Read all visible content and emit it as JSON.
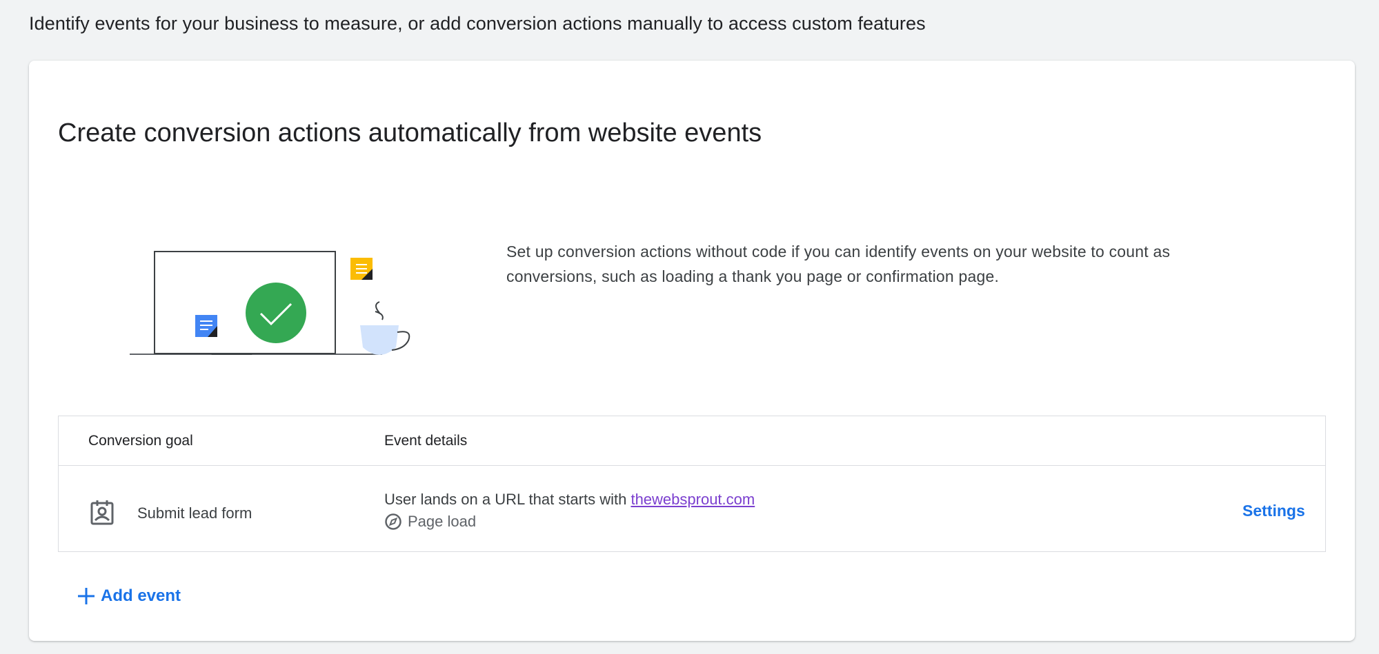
{
  "page": {
    "subtitle": "Identify events for your business to measure, or add conversion actions manually to access custom features"
  },
  "card": {
    "title": "Create conversion actions automatically from website events",
    "description": "Set up conversion actions without code if you can identify events on your website to count as conversions, such as loading a thank you page or confirmation page."
  },
  "table": {
    "headers": {
      "goal": "Conversion goal",
      "details": "Event details"
    },
    "rows": [
      {
        "goal": "Submit lead form",
        "goal_icon": "contact-form-icon",
        "event_prefix": "User lands on a URL that starts with ",
        "event_link": "thewebsprout.com",
        "event_type": "Page load",
        "event_type_icon": "compass-icon",
        "action": "Settings"
      }
    ]
  },
  "add_event": {
    "label": "Add event",
    "icon": "plus-icon"
  },
  "colors": {
    "accent": "#1a73e8",
    "link_visited": "#7b3fcf",
    "success": "#34a853",
    "background": "#f1f3f4"
  }
}
